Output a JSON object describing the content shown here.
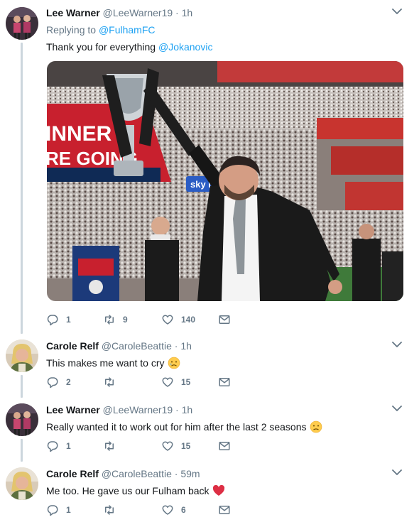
{
  "tweets": [
    {
      "name": "Lee Warner",
      "handle": "@LeeWarner19",
      "time": "1h",
      "replying_to_prefix": "Replying to",
      "replying_to": "@FulhamFC",
      "text_prefix": "Thank you for everything",
      "text_mention": "@Jokanovic",
      "media_description": "Manager holding Championship play-off trophy at Wembley",
      "media_banner_lines": [
        "INNER",
        "RE GOING"
      ],
      "media_sponsor": "sky bet",
      "counts": {
        "reply": "1",
        "retweet": "9",
        "like": "140"
      }
    },
    {
      "name": "Carole Relf",
      "handle": "@CaroleBeattie",
      "time": "1h",
      "text": "This makes me want to cry",
      "emoji": "crying-face-icon",
      "counts": {
        "reply": "2",
        "retweet": "",
        "like": "15"
      }
    },
    {
      "name": "Lee Warner",
      "handle": "@LeeWarner19",
      "time": "1h",
      "text": "Really wanted it to work out for him after the last 2 seasons",
      "emoji": "frowning-face-icon",
      "counts": {
        "reply": "1",
        "retweet": "",
        "like": "15"
      }
    },
    {
      "name": "Carole Relf",
      "handle": "@CaroleBeattie",
      "time": "59m",
      "text": "Me too. He gave us our Fulham back",
      "emoji": "red-heart-icon",
      "counts": {
        "reply": "1",
        "retweet": "",
        "like": "6"
      }
    }
  ],
  "colors": {
    "link": "#1da1f2",
    "secondary_text": "#657786",
    "primary_text": "#14171a",
    "thread_line": "#ccd6dd",
    "heart": "#e0245e"
  },
  "separator": "·"
}
